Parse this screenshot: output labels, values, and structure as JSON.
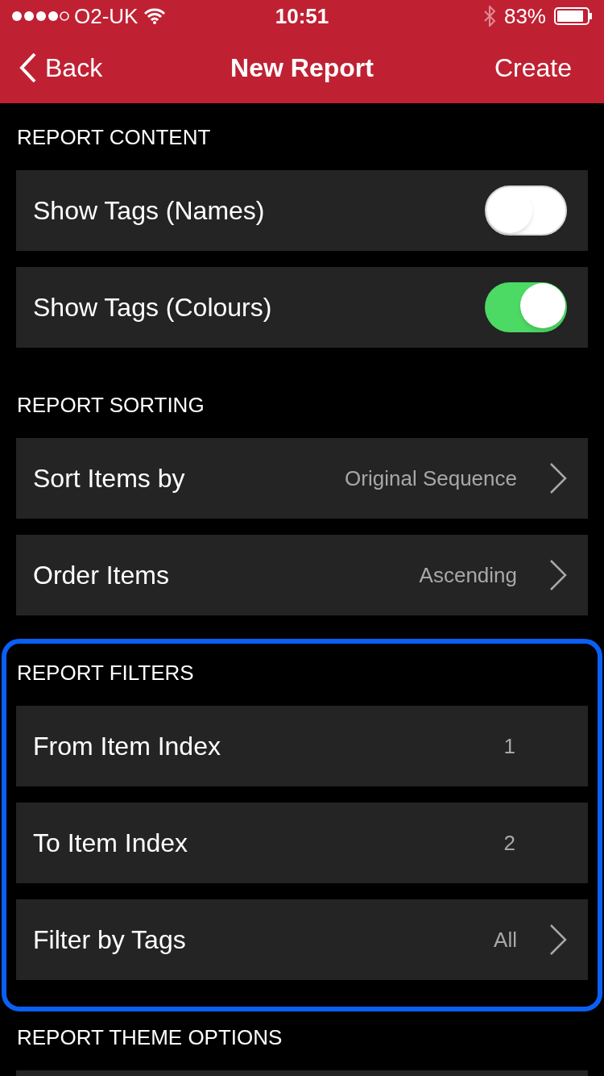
{
  "status_bar": {
    "carrier": "O2-UK",
    "time": "10:51",
    "battery": "83%"
  },
  "nav": {
    "back": "Back",
    "title": "New Report",
    "action": "Create"
  },
  "sections": [
    {
      "title": "REPORT CONTENT",
      "highlighted": false,
      "rows": [
        {
          "kind": "toggle",
          "label": "Show Tags (Names)",
          "on": false
        },
        {
          "kind": "toggle",
          "label": "Show Tags (Colours)",
          "on": true
        }
      ]
    },
    {
      "title": "REPORT SORTING",
      "highlighted": false,
      "rows": [
        {
          "kind": "disclosure",
          "label": "Sort Items by",
          "value": "Original Sequence"
        },
        {
          "kind": "disclosure",
          "label": "Order Items",
          "value": "Ascending"
        }
      ]
    },
    {
      "title": "REPORT FILTERS",
      "highlighted": true,
      "rows": [
        {
          "kind": "value",
          "label": "From Item Index",
          "value": "1"
        },
        {
          "kind": "value",
          "label": "To Item Index",
          "value": "2"
        },
        {
          "kind": "disclosure",
          "label": "Filter by Tags",
          "value": "All"
        }
      ]
    },
    {
      "title": "REPORT THEME OPTIONS",
      "highlighted": false
    }
  ]
}
